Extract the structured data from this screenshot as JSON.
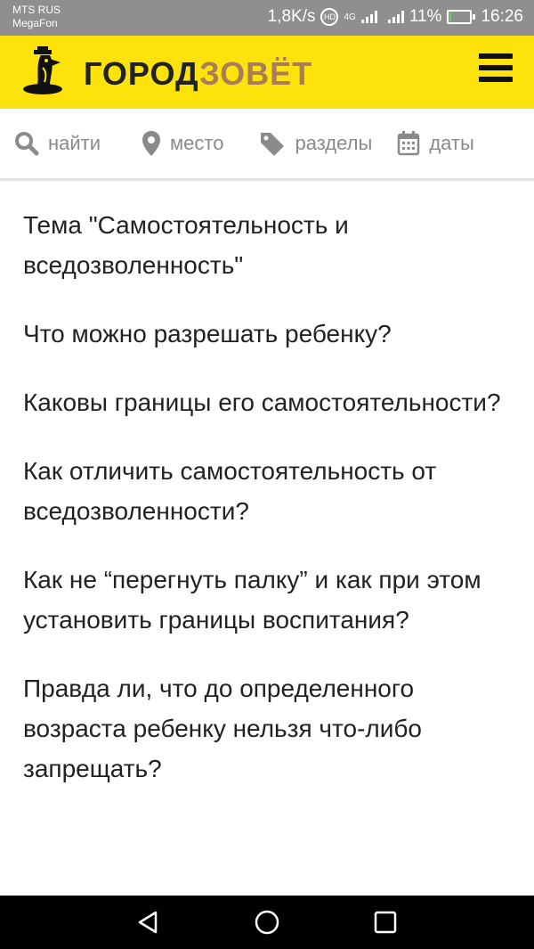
{
  "status_bar": {
    "carrier_line1": "MTS RUS",
    "carrier_line2": "MegaFon",
    "network_speed": "1,8K/s",
    "net_type": "4G",
    "battery_percent": "11%",
    "battery_level": 0.11,
    "time": "16:26"
  },
  "header": {
    "logo_part1": "ГОРОД",
    "logo_part2": "ЗОВЁТ",
    "logo_icon": "hat-mascot-icon",
    "menu_icon": "hamburger-menu-icon",
    "accent_color": "#fde30b",
    "brand_brown": "#a77d5a"
  },
  "filters": {
    "search_label": "найти",
    "place_label": "место",
    "sections_label": "разделы",
    "dates_label": "даты"
  },
  "questions": [
    "Тема \"Самостоятельность и вседозволенность\"",
    "Что можно разрешать ребенку?",
    "Каковы границы его самостоятельности?",
    "Как отличить самостоятельность от вседозволенности?",
    "Как не “перегнуть палку” и как при этом установить границы воспитания?",
    "Правда ли, что до определенного возраста ребенку нельзя что-либо запрещать?"
  ],
  "nav_bar": {
    "back_icon": "back-triangle-icon",
    "home_icon": "home-circle-icon",
    "recents_icon": "recents-square-icon"
  }
}
